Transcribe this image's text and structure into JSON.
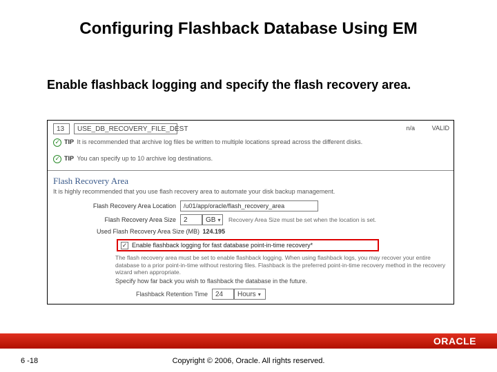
{
  "title": "Configuring Flashback Database Using EM",
  "subtitle": "Enable flashback logging and specify the flash recovery area.",
  "panel": {
    "row1": {
      "num": "13",
      "dest": "USE_DB_RECOVERY_FILE_DEST",
      "rate": "n/a",
      "status": "VALID"
    },
    "tips": {
      "label": "TIP",
      "t1": "It is recommended that archive log files be written to multiple locations spread across the different disks.",
      "t2": "You can specify up to 10 archive log destinations."
    },
    "section": {
      "heading": "Flash Recovery Area",
      "desc": "It is highly recommended that you use flash recovery area to automate your disk backup management."
    },
    "location": {
      "label": "Flash Recovery Area Location",
      "value": "/u01/app/oracle/flash_recovery_area"
    },
    "size": {
      "label": "Flash Recovery Area Size",
      "value": "2",
      "unit": "GB",
      "hint": "Recovery Area Size must be set when the location is set."
    },
    "used": {
      "label": "Used Flash Recovery Area Size (MB)",
      "value": "124.195"
    },
    "enable": {
      "checked": true,
      "label": "Enable flashback logging for fast database point-in-time recovery*"
    },
    "explain": "The flash recovery area must be set to enable flashback logging. When using flashback logs, you may recover your entire database to a prior point-in-time without restoring files. Flashback is the preferred point-in-time recovery method in the recovery wizard when appropriate.",
    "specify": "Specify how far back you wish to flashback the database in the future.",
    "retention": {
      "label": "Flashback Retention Time",
      "value": "24",
      "unit": "Hours"
    }
  },
  "footer": {
    "page": "6 -18",
    "copyright": "Copyright © 2006, Oracle. All rights reserved.",
    "logo": "ORACLE"
  }
}
